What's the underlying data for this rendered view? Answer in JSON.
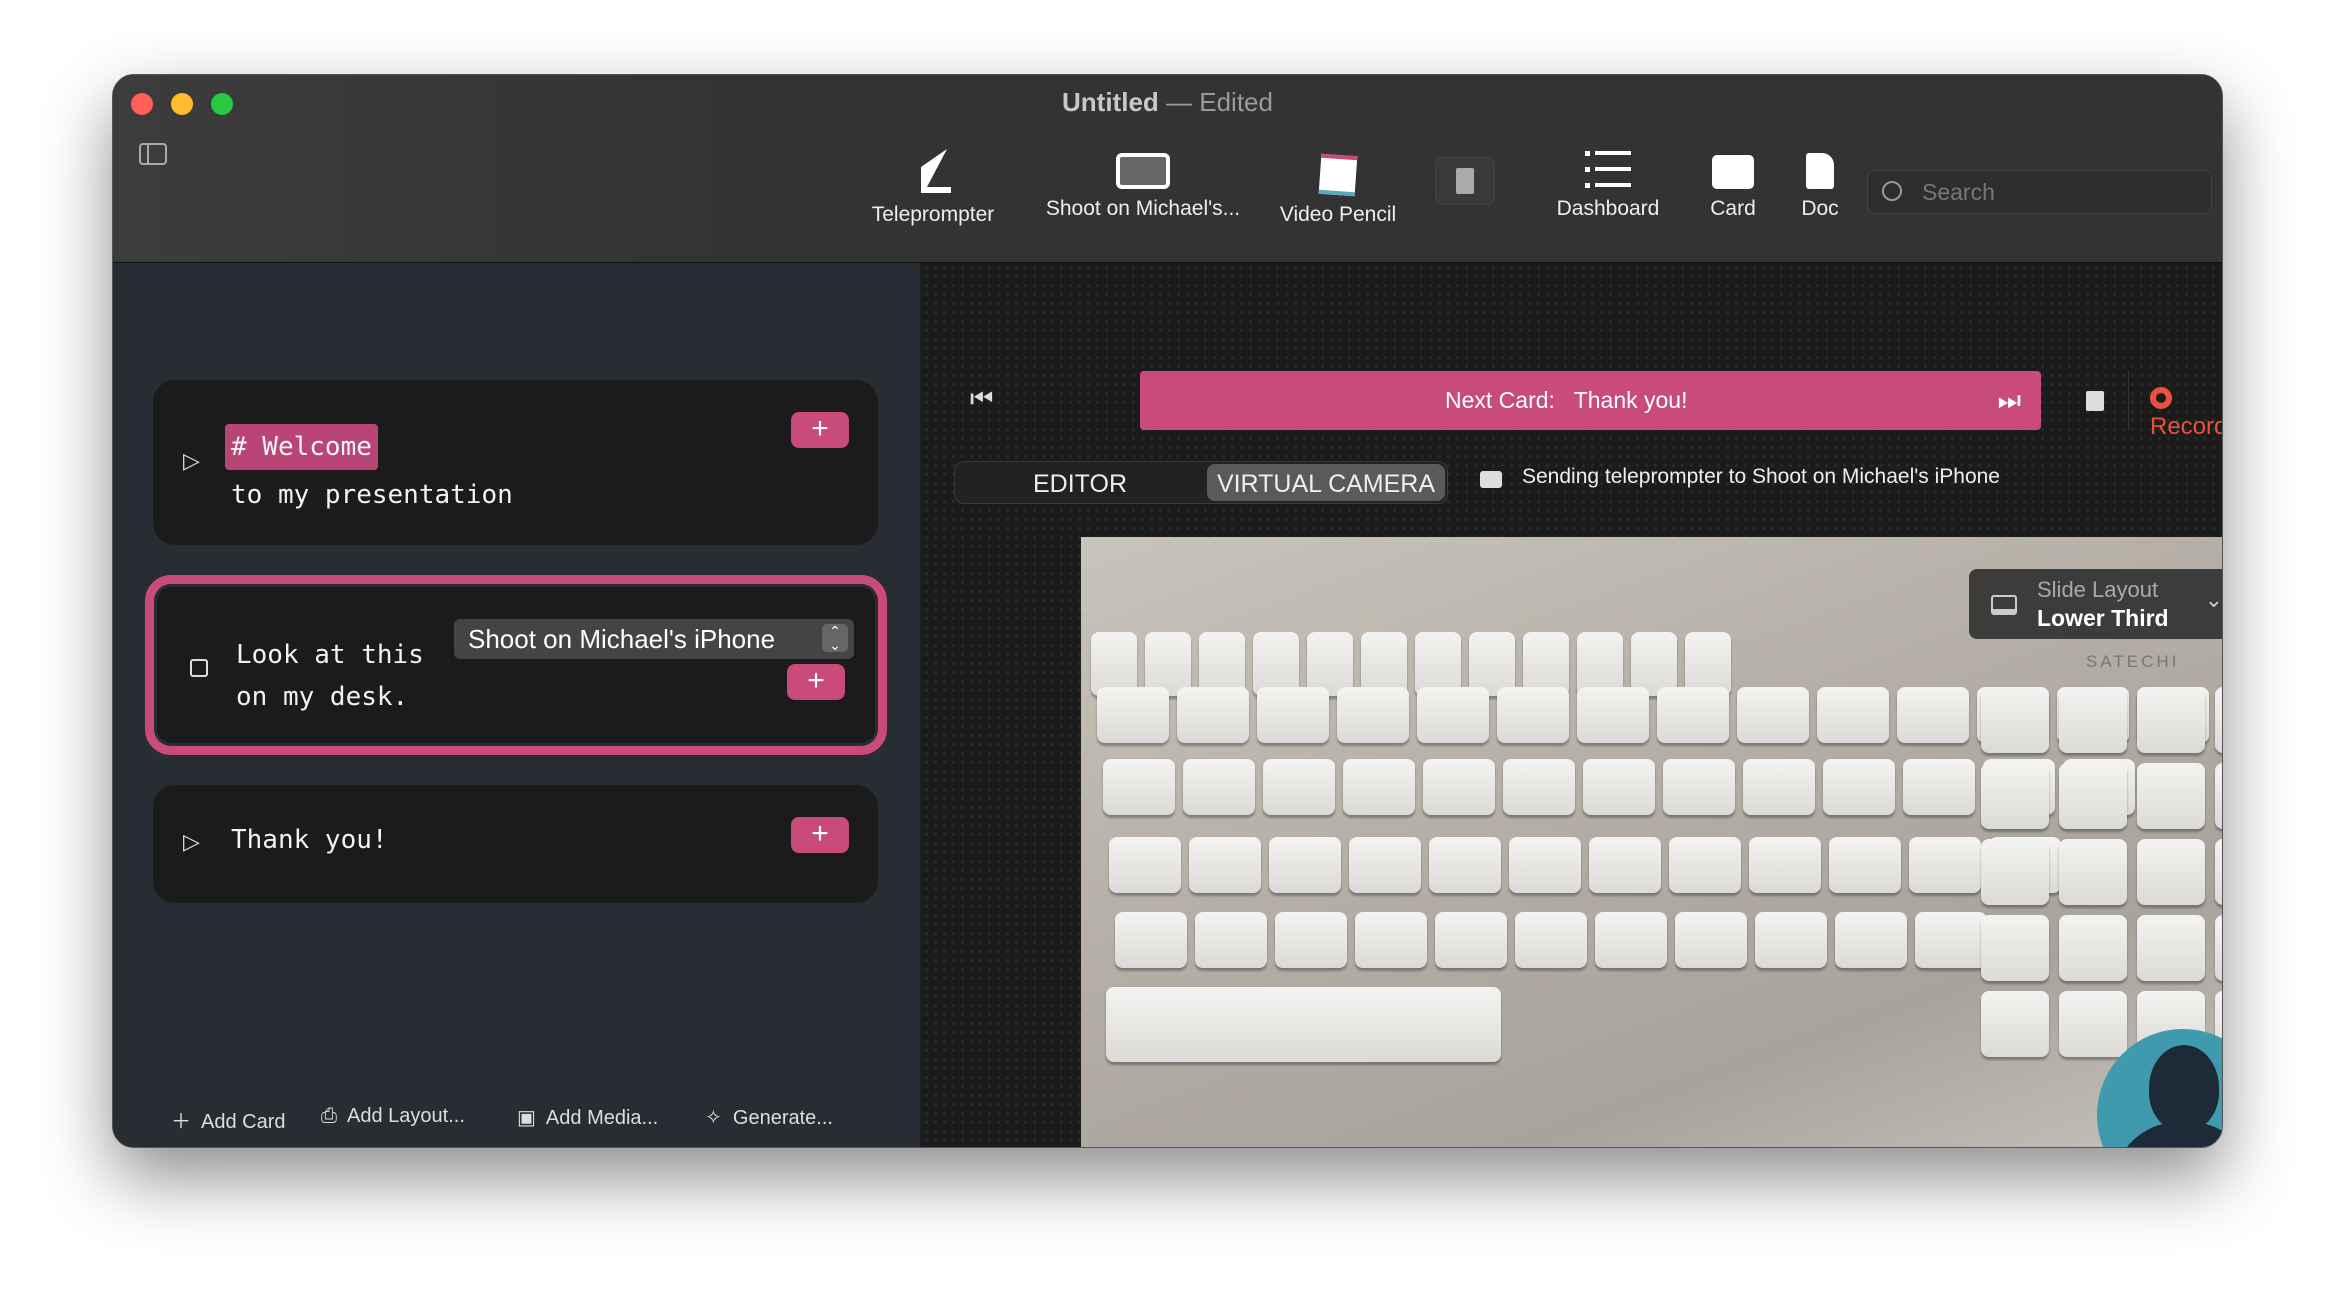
{
  "window": {
    "title": "Untitled",
    "subtitle": "Edited"
  },
  "toolbar": {
    "items": [
      {
        "label": "Teleprompter",
        "icon": "teleprompter-icon"
      },
      {
        "label": "Shoot on Michael's...",
        "icon": "display-icon"
      },
      {
        "label": "Video Pencil",
        "icon": "video-pencil-icon"
      },
      {
        "label": "",
        "icon": "upload-doc-icon"
      },
      {
        "label": "Dashboard",
        "icon": "list-icon"
      },
      {
        "label": "Card",
        "icon": "card-icon"
      },
      {
        "label": "Doc",
        "icon": "doc-icon"
      }
    ],
    "search_placeholder": "Search"
  },
  "cards": [
    {
      "heading": "# Welcome",
      "text": "to my presentation"
    },
    {
      "line1": "Look at this",
      "line2": "on my desk.",
      "device": "Shoot on Michael's iPhone"
    },
    {
      "text": "Thank you!"
    }
  ],
  "bottom": {
    "add_card": "Add Card",
    "add_layout": "Add Layout...",
    "add_media": "Add Media...",
    "generate": "Generate..."
  },
  "player": {
    "next_label": "Next Card:",
    "next_value": "Thank you!",
    "record": "Record",
    "record_color": "#e8503f",
    "accent": "#c94b7c"
  },
  "tabs": {
    "editor": "EDITOR",
    "virtual_camera": "VIRTUAL CAMERA",
    "active": "VIRTUAL CAMERA"
  },
  "status": "Sending teleprompter to Shoot on Michael's iPhone",
  "slide_layout": {
    "label": "Slide Layout",
    "value": "Lower Third"
  },
  "keyboard": {
    "brand": "SATECHI"
  }
}
